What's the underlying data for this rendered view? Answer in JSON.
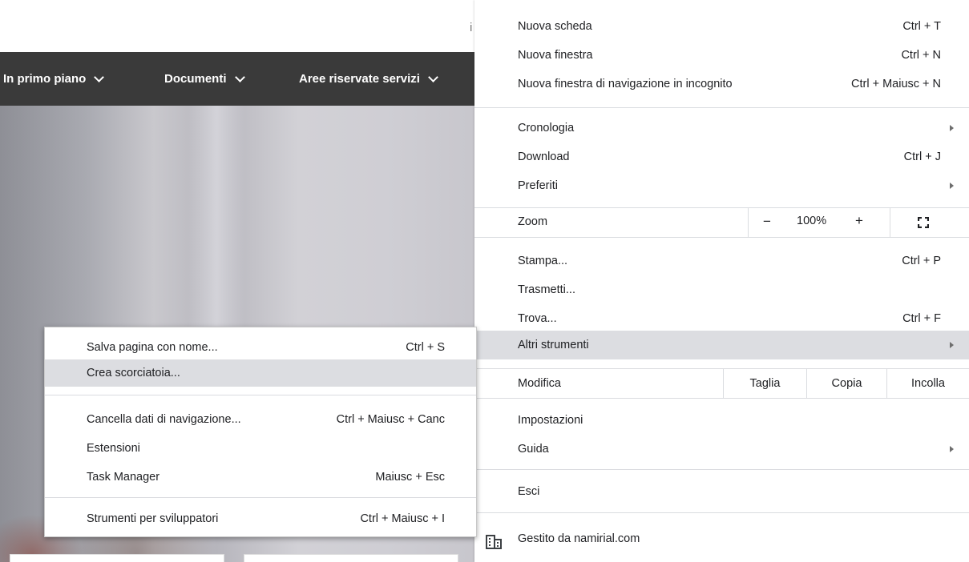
{
  "webpage": {
    "top_text": "i",
    "nav": [
      {
        "label": "In primo piano"
      },
      {
        "label": "Documenti"
      },
      {
        "label": "Aree riservate servizi"
      }
    ]
  },
  "main_menu": {
    "new_tab": {
      "label": "Nuova scheda",
      "shortcut": "Ctrl + T"
    },
    "new_window": {
      "label": "Nuova finestra",
      "shortcut": "Ctrl + N"
    },
    "incognito": {
      "label": "Nuova finestra di navigazione in incognito",
      "shortcut": "Ctrl + Maiusc + N"
    },
    "history": {
      "label": "Cronologia"
    },
    "downloads": {
      "label": "Download",
      "shortcut": "Ctrl + J"
    },
    "bookmarks": {
      "label": "Preferiti"
    },
    "zoom": {
      "label": "Zoom",
      "minus": "−",
      "value": "100%",
      "plus": "+"
    },
    "print": {
      "label": "Stampa...",
      "shortcut": "Ctrl + P"
    },
    "cast": {
      "label": "Trasmetti..."
    },
    "find": {
      "label": "Trova...",
      "shortcut": "Ctrl + F"
    },
    "more_tools": {
      "label": "Altri strumenti"
    },
    "edit": {
      "label": "Modifica",
      "cut": "Taglia",
      "copy": "Copia",
      "paste": "Incolla"
    },
    "settings": {
      "label": "Impostazioni"
    },
    "help": {
      "label": "Guida"
    },
    "exit": {
      "label": "Esci"
    },
    "managed": {
      "label": "Gestito da namirial.com"
    }
  },
  "more_tools_menu": {
    "save_page": {
      "label": "Salva pagina con nome...",
      "shortcut": "Ctrl + S"
    },
    "create_shortcut": {
      "label": "Crea scorciatoia..."
    },
    "clear_data": {
      "label": "Cancella dati di navigazione...",
      "shortcut": "Ctrl + Maiusc + Canc"
    },
    "extensions": {
      "label": "Estensioni"
    },
    "task_manager": {
      "label": "Task Manager",
      "shortcut": "Maiusc + Esc"
    },
    "dev_tools": {
      "label": "Strumenti per sviluppatori",
      "shortcut": "Ctrl + Maiusc + I"
    }
  },
  "colors": {
    "highlight": "#dcdde1",
    "nav_bar": "#3a3a3a",
    "separator": "#dadce0",
    "text": "#202124"
  },
  "icons": {
    "submenu_arrow": "chevron-right-icon",
    "fullscreen": "fullscreen-icon",
    "managed": "building-icon",
    "nav_dropdown": "chevron-down-icon"
  }
}
